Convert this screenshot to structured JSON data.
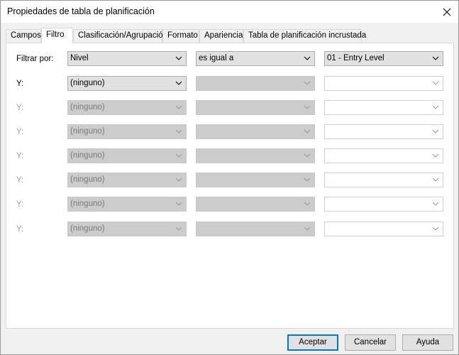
{
  "window": {
    "title": "Propiedades de tabla de planificación"
  },
  "tabs": [
    {
      "label": "Campos"
    },
    {
      "label": "Filtro"
    },
    {
      "label": "Clasificación/Agrupación"
    },
    {
      "label": "Formato"
    },
    {
      "label": "Apariencia"
    },
    {
      "label": "Tabla de planificación incrustada"
    }
  ],
  "filter": {
    "filter_by_label": "Filtrar por:",
    "field": "Nivel",
    "operator": "es igual a",
    "value": "01 - Entry Level",
    "and_label": "Y:",
    "none_option": "(ninguno)"
  },
  "buttons": {
    "ok": "Aceptar",
    "cancel": "Cancelar",
    "help": "Ayuda"
  },
  "colors": {
    "primary_border": "#0078d7",
    "disabled_bg": "#cccccc",
    "disabled_text": "#a0a0a0"
  },
  "icons": {
    "close": "close-icon",
    "dropdown": "chevron-down-icon"
  }
}
